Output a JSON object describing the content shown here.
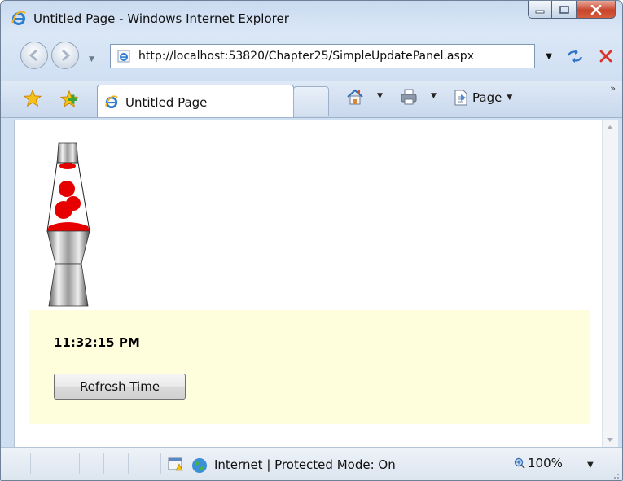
{
  "window": {
    "title": "Untitled Page - Windows Internet Explorer"
  },
  "address_bar": {
    "url": "http://localhost:53820/Chapter25/SimpleUpdatePanel.aspx"
  },
  "tab": {
    "label": "Untitled Page"
  },
  "command_bar": {
    "page_label": "Page",
    "more_chevron": "»"
  },
  "page": {
    "time_text": "11:32:15 PM",
    "refresh_button_label": "Refresh Time",
    "panel_color": "#fffedc"
  },
  "status_bar": {
    "zone_text": "Internet | Protected Mode: On",
    "zoom_text": "100%"
  },
  "icons": [
    "ie-logo-icon",
    "minimize-icon",
    "maximize-icon",
    "close-icon",
    "back-icon",
    "forward-icon",
    "refresh-icon",
    "stop-icon",
    "favorites-star-icon",
    "add-favorites-icon",
    "home-icon",
    "print-icon",
    "page-icon",
    "zoom-icon",
    "globe-icon",
    "lava-lamp-image"
  ]
}
